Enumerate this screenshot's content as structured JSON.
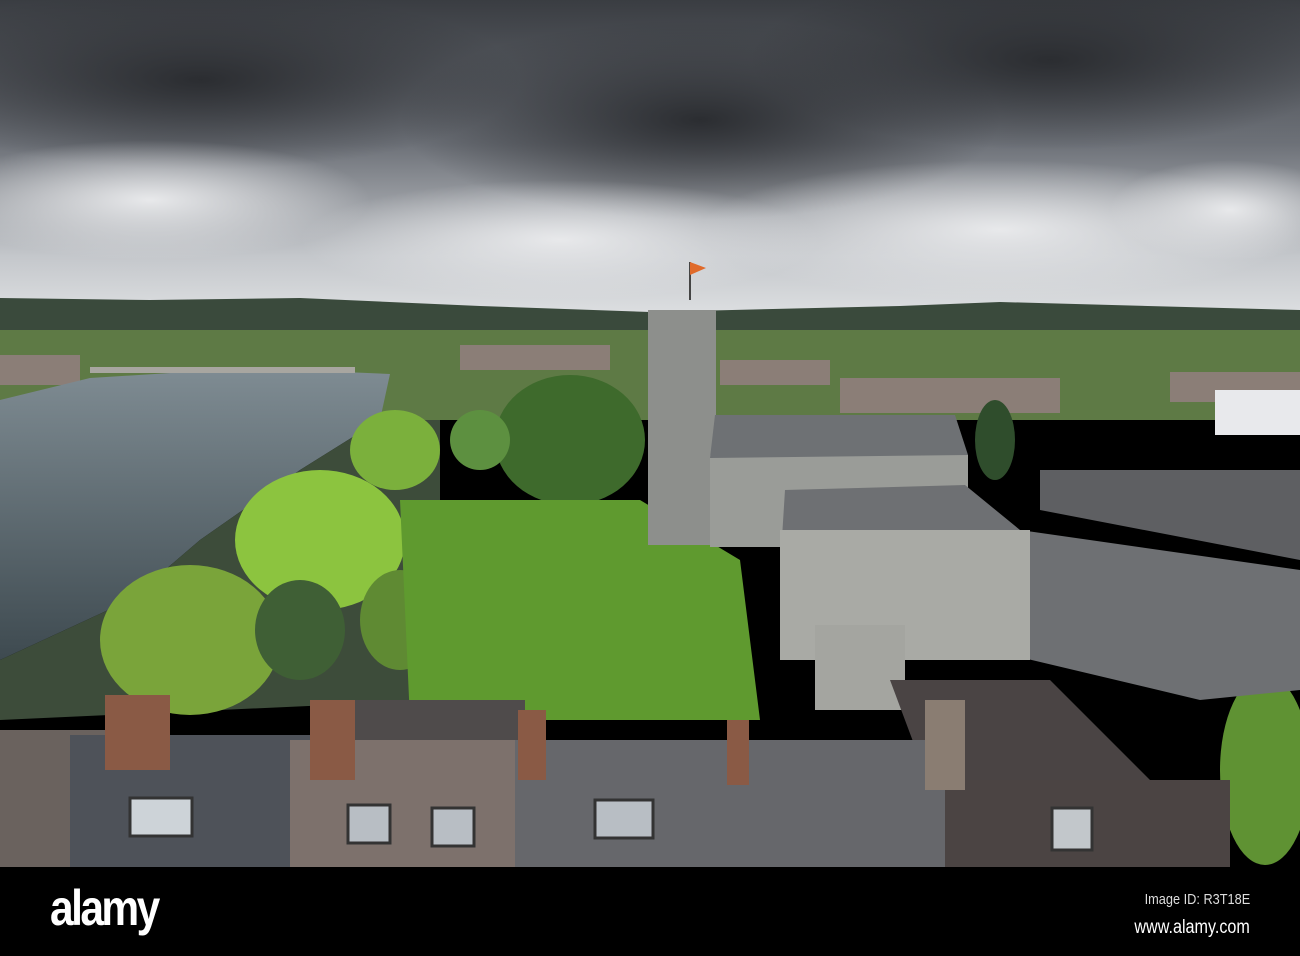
{
  "photo": {
    "subject": "church-and-river-aerial"
  },
  "watermark": {
    "text": "alamy"
  },
  "footer": {
    "logo": "alamy",
    "image_id": "Image ID: R3T18E",
    "website": "www.alamy.com"
  }
}
